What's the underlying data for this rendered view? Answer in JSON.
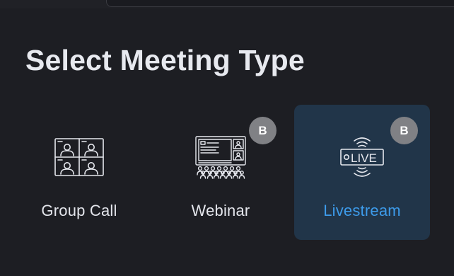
{
  "page": {
    "title": "Select Meeting Type"
  },
  "meeting_types": [
    {
      "label": "Group Call",
      "icon": "group-call-grid-icon",
      "selected": false,
      "badge": ""
    },
    {
      "label": "Webinar",
      "icon": "webinar-presentation-icon",
      "selected": false,
      "badge": "B"
    },
    {
      "label": "Livestream",
      "icon": "live-broadcast-icon",
      "selected": true,
      "badge": "B"
    }
  ],
  "live_icon_text": "LIVE",
  "colors": {
    "background": "#1d1e23",
    "title": "#e7e9ef",
    "label": "#e4e6ec",
    "selected_card_bg": "#213549",
    "selected_label": "#3d9bea",
    "badge_bg": "#808185",
    "icon_stroke": "#e6e8ee"
  }
}
